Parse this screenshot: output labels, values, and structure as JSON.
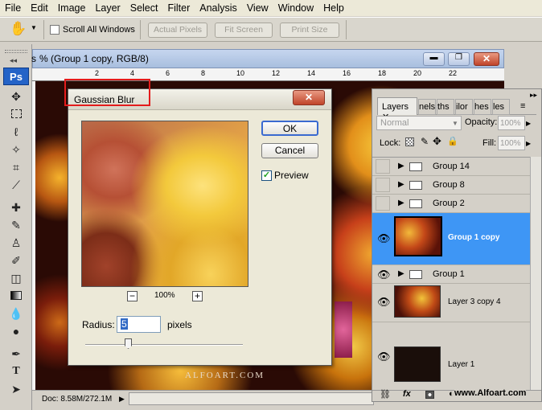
{
  "menu": [
    "File",
    "Edit",
    "Image",
    "Layer",
    "Select",
    "Filter",
    "Analysis",
    "View",
    "Window",
    "Help"
  ],
  "options": {
    "scroll_all_windows": "Scroll All Windows",
    "actual_pixels": "Actual Pixels",
    "fit_screen": "Fit Screen",
    "print_size": "Print Size"
  },
  "tools": {
    "logo": "Ps"
  },
  "document": {
    "title": "% (Group 1 copy, RGB/8)",
    "title_prefix": "s",
    "ruler_ticks": [
      "2",
      "4",
      "6",
      "8",
      "10",
      "12",
      "14",
      "16",
      "18",
      "20",
      "22"
    ],
    "status": "Doc: 8.58M/272.1M",
    "canvas_watermark": "ALFOART.COM"
  },
  "dialog": {
    "title": "Gaussian Blur",
    "ok": "OK",
    "cancel": "Cancel",
    "preview_label": "Preview",
    "preview_checked": true,
    "zoom": "100%",
    "radius_label": "Radius:",
    "radius_value": "5",
    "radius_unit": "pixels"
  },
  "layers_panel": {
    "tabs": [
      "Layers",
      "nels",
      "ths",
      "ilor",
      "hes",
      "les"
    ],
    "blend_mode": "Normal",
    "opacity_label": "Opacity:",
    "opacity_value": "100%",
    "lock_label": "Lock:",
    "fill_label": "Fill:",
    "fill_value": "100%",
    "layers": [
      "Group 14",
      "Group 8",
      "Group 2",
      "Group 1 copy",
      "Group 1",
      "Layer 3 copy 4",
      "Layer 1"
    ],
    "footer_watermark": "www.Alfoart.com",
    "selected_color": "#3e96f5"
  }
}
